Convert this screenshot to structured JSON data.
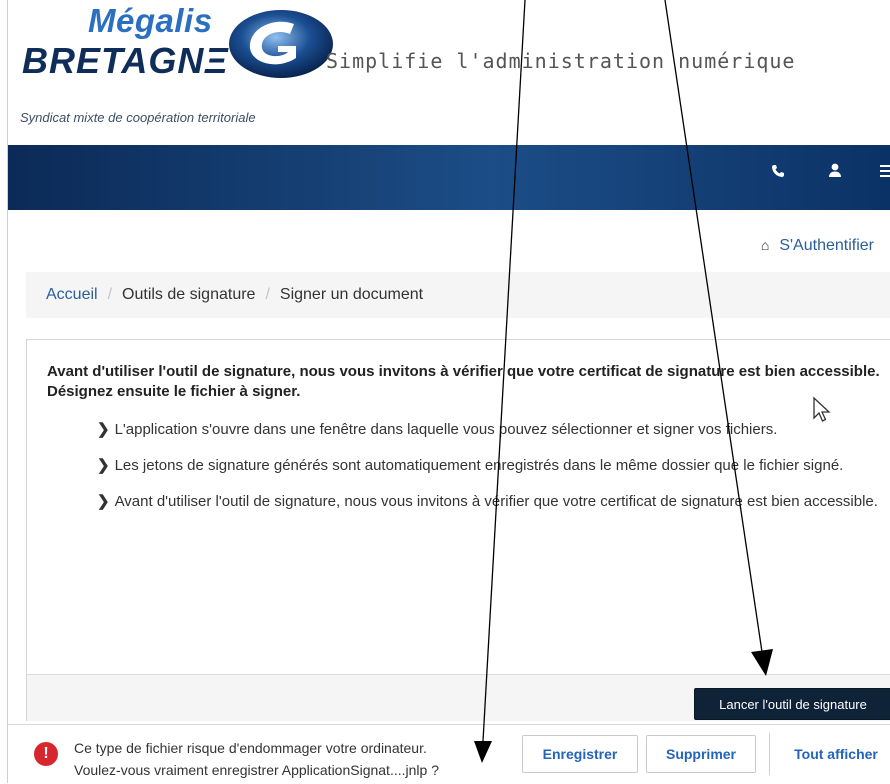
{
  "header": {
    "logo_line1": "Mégalis",
    "logo_line2": "BRETAGNΞ",
    "tagline": "Simplifie l'administration numérique",
    "subtitle": "Syndicat mixte de coopération territoriale"
  },
  "banner": {
    "icons": [
      "phone-icon",
      "user-icon",
      "menu-icon"
    ]
  },
  "auth": {
    "label": "S'Authentifier",
    "icon": "home-icon"
  },
  "breadcrumb": {
    "items": [
      "Accueil",
      "Outils de signature",
      "Signer un document"
    ],
    "separator": "/"
  },
  "panel": {
    "intro_line1": "Avant d'utiliser l'outil de signature, nous vous invitons à vérifier que votre certificat de signature est bien accessible.",
    "intro_line2": "Désignez ensuite le fichier à signer.",
    "bullets": [
      "L'application s'ouvre dans une fenêtre dans laquelle vous pouvez sélectionner et signer vos fichiers.",
      "Les jetons de signature générés sont automatiquement enregistrés dans le même dossier que le fichier signé.",
      "Avant d'utiliser l'outil de signature, nous vous invitons à vérifier que votre certificat de signature est bien accessible."
    ],
    "launch_button": "Lancer l'outil de signature"
  },
  "download_bar": {
    "line1": "Ce type de fichier risque d'endommager votre ordinateur.",
    "line2": "Voulez-vous vraiment enregistrer ApplicationSignat....jnlp ?",
    "save_button": "Enregistrer",
    "discard_button": "Supprimer",
    "show_all_button": "Tout afficher"
  },
  "colors": {
    "banner": "#0b2a57",
    "link": "#2a5f99",
    "launch_button_bg": "#0e2238",
    "warning": "#d8262e",
    "download_button_text": "#2464b8"
  }
}
